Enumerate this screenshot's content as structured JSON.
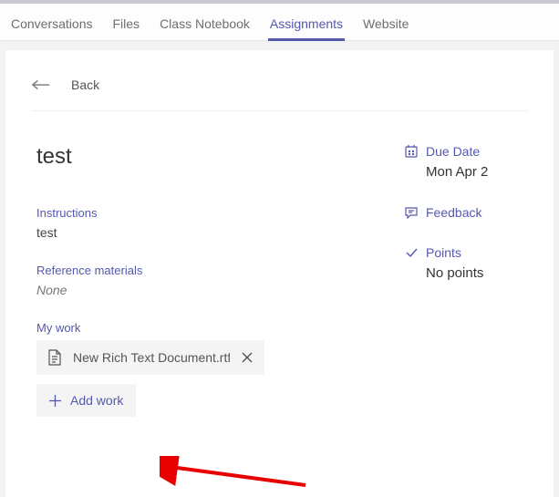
{
  "tabs": {
    "conversations": "Conversations",
    "files": "Files",
    "classNotebook": "Class Notebook",
    "assignments": "Assignments",
    "website": "Website",
    "active": "assignments"
  },
  "back": {
    "label": "Back"
  },
  "assignment": {
    "title": "test",
    "instructionsLabel": "Instructions",
    "instructionsBody": "test",
    "referenceLabel": "Reference materials",
    "referenceBody": "None",
    "myWorkLabel": "My work",
    "fileName": "New Rich Text Document.rtf",
    "addWorkLabel": "Add work"
  },
  "meta": {
    "dueLabel": "Due Date",
    "dueValue": "Mon Apr 2",
    "feedbackLabel": "Feedback",
    "pointsLabel": "Points",
    "pointsValue": "No points"
  }
}
